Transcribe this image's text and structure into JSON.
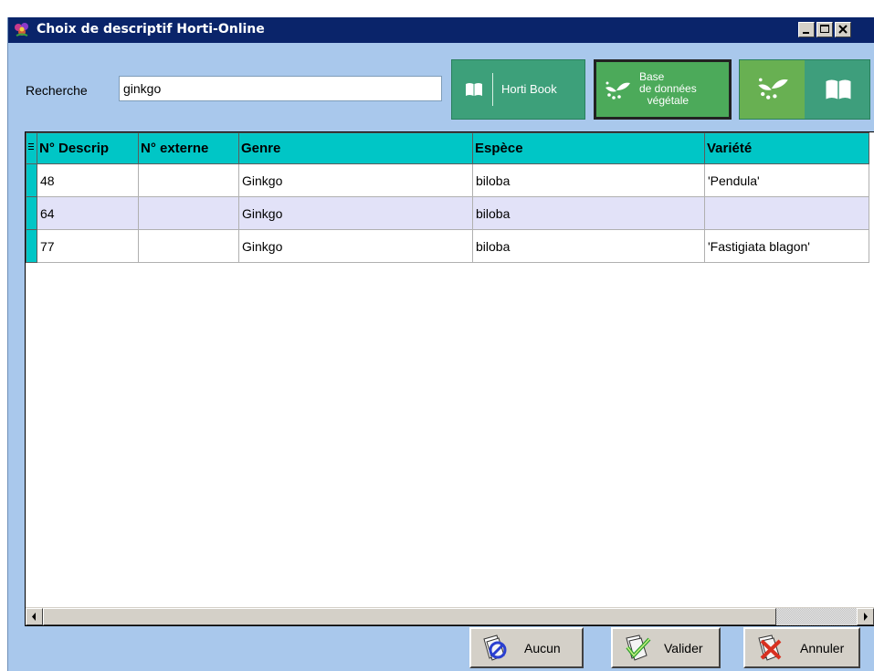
{
  "window": {
    "title": "Choix de descriptif Horti-Online",
    "title_bar_color": "#0a246a",
    "background_color": "#a9c8ec"
  },
  "search": {
    "label": "Recherche",
    "value": "ginkgo"
  },
  "source_buttons": {
    "horti_book_label": "Horti Book",
    "base_donnees_line1": "Base",
    "base_donnees_line2": "de données",
    "base_donnees_line3": "végétale",
    "accent_teal": "#3da07a",
    "accent_green": "#4caa5a"
  },
  "table": {
    "columns": [
      "N° Descrip",
      "N° externe",
      "Genre",
      "Espèce",
      "Variété"
    ],
    "rows": [
      [
        "48",
        "",
        "Ginkgo",
        "biloba",
        "'Pendula'"
      ],
      [
        "64",
        "",
        "Ginkgo",
        "biloba",
        ""
      ],
      [
        "77",
        "",
        "Ginkgo",
        "biloba",
        "'Fastigiata blagon'"
      ]
    ],
    "header_color": "#00c6c6",
    "alt_row_color": "#e2e2f8"
  },
  "buttons": {
    "aucun": "Aucun",
    "valider": "Valider",
    "annuler": "Annuler"
  }
}
